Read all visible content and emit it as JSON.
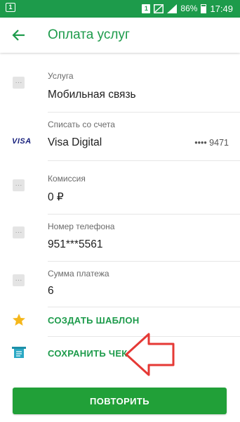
{
  "status_bar": {
    "left_badge": "1",
    "sim": "1",
    "battery": "86%",
    "time": "17:49"
  },
  "toolbar": {
    "title": "Оплата услуг"
  },
  "fields": {
    "service_label": "Услуга",
    "service_value": "Мобильная связь",
    "account_label": "Списать со счета",
    "card_logo": "VISA",
    "account_value": "Visa Digital",
    "account_masked": "•••• 9471",
    "commission_label": "Комиссия",
    "commission_value": "0 ₽",
    "phone_label": "Номер телефона",
    "phone_value": "951***5561",
    "amount_label": "Сумма платежа",
    "amount_value": "6"
  },
  "actions": {
    "create_template": "СОЗДАТЬ ШАБЛОН",
    "save_receipt": "СОХРАНИТЬ ЧЕК",
    "repeat": "ПОВТОРИТЬ"
  },
  "colors": {
    "brand_green": "#1d9b4b",
    "button_green": "#21a038",
    "star_yellow": "#f5b71b",
    "annotation_red": "#e53935"
  },
  "icons": {
    "back": "arrow-left-icon",
    "field": "ellipsis-icon",
    "template": "star-icon",
    "receipt": "receipt-icon",
    "annotation": "arrow-pointer-icon"
  }
}
